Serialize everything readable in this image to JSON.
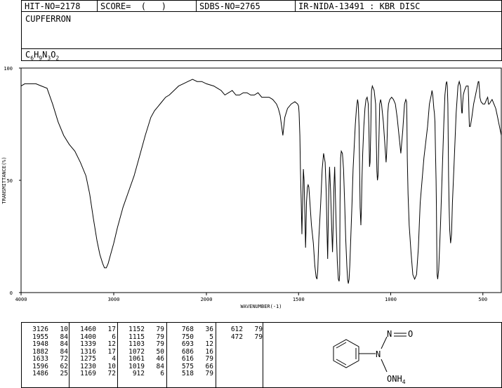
{
  "header": {
    "hit_no": "HIT-NO=2178",
    "score": "SCORE=  (   )",
    "sdbs_no": "SDBS-NO=2765",
    "ir_nida": "IR-NIDA-13491 : KBR DISC"
  },
  "compound": {
    "name": "CUPFERRON",
    "formula_parts": [
      "C",
      "6",
      "H",
      "9",
      "N",
      "3",
      "O",
      "2"
    ]
  },
  "chart_data": {
    "type": "line",
    "xlabel": "WAVENUMBER(-1)",
    "ylabel": "TRANSMITTANCE(%)",
    "xlim": [
      4000,
      400
    ],
    "ylim": [
      0,
      100
    ],
    "x_ticks": [
      "4000",
      "3000",
      "2000",
      "1500",
      "1000",
      "500"
    ],
    "y_ticks": [
      "100",
      "50",
      "0"
    ],
    "x": [
      4000,
      3960,
      3900,
      3840,
      3780,
      3720,
      3660,
      3600,
      3540,
      3480,
      3420,
      3360,
      3300,
      3260,
      3220,
      3180,
      3150,
      3120,
      3100,
      3080,
      3060,
      3040,
      3000,
      2960,
      2900,
      2840,
      2780,
      2720,
      2660,
      2600,
      2560,
      2520,
      2480,
      2440,
      2400,
      2350,
      2300,
      2250,
      2200,
      2150,
      2100,
      2050,
      2000,
      1960,
      1940,
      1920,
      1900,
      1880,
      1860,
      1840,
      1820,
      1800,
      1780,
      1760,
      1740,
      1720,
      1700,
      1680,
      1660,
      1640,
      1620,
      1610,
      1600,
      1595,
      1590,
      1585,
      1575,
      1560,
      1540,
      1520,
      1505,
      1500,
      1497,
      1493,
      1490,
      1486,
      1482,
      1478,
      1474,
      1470,
      1466,
      1462,
      1460,
      1457,
      1452,
      1448,
      1444,
      1440,
      1430,
      1420,
      1412,
      1405,
      1400,
      1396,
      1390,
      1380,
      1372,
      1364,
      1356,
      1350,
      1346,
      1342,
      1339,
      1336,
      1332,
      1326,
      1320,
      1316,
      1312,
      1308,
      1304,
      1300,
      1296,
      1290,
      1284,
      1280,
      1277,
      1275,
      1272,
      1268,
      1262,
      1256,
      1250,
      1244,
      1238,
      1234,
      1230,
      1226,
      1222,
      1216,
      1210,
      1204,
      1198,
      1192,
      1186,
      1180,
      1176,
      1172,
      1169,
      1166,
      1162,
      1159,
      1156,
      1152,
      1146,
      1140,
      1134,
      1128,
      1122,
      1118,
      1115,
      1112,
      1108,
      1106,
      1104,
      1100,
      1090,
      1082,
      1078,
      1075,
      1072,
      1069,
      1066,
      1062,
      1060,
      1055,
      1050,
      1040,
      1030,
      1025,
      1022,
      1019,
      1016,
      1012,
      1005,
      995,
      985,
      975,
      965,
      955,
      945,
      935,
      925,
      918,
      914,
      912,
      910,
      906,
      900,
      890,
      880,
      870,
      860,
      850,
      840,
      820,
      800,
      790,
      780,
      776,
      772,
      770,
      768,
      766,
      763,
      760,
      757,
      754,
      752,
      750,
      748,
      745,
      740,
      730,
      720,
      712,
      706,
      700,
      696,
      693,
      690,
      688,
      686,
      683,
      680,
      675,
      670,
      665,
      655,
      645,
      635,
      628,
      622,
      618,
      616,
      614,
      612,
      610,
      606,
      600,
      590,
      580,
      577,
      575,
      573,
      568,
      560,
      550,
      540,
      530,
      525,
      522,
      520,
      518,
      516,
      510,
      500,
      490,
      480,
      474,
      472,
      470,
      465,
      458,
      450,
      440,
      430,
      420,
      410,
      400
    ],
    "y": [
      92,
      93,
      93,
      93,
      92,
      91,
      84,
      76,
      70,
      66,
      63,
      58,
      52,
      44,
      33,
      23,
      17,
      13,
      11,
      11,
      13,
      16,
      22,
      29,
      38,
      45,
      52,
      61,
      70,
      78,
      81,
      83,
      85,
      87,
      88,
      90,
      92,
      93,
      94,
      95,
      94,
      94,
      93,
      92,
      91,
      90,
      88,
      89,
      90,
      88,
      88,
      89,
      89,
      88,
      88,
      89,
      87,
      87,
      87,
      86,
      84,
      82,
      79,
      76,
      73,
      70,
      78,
      82,
      84,
      85,
      84,
      83,
      80,
      70,
      55,
      42,
      26,
      40,
      55,
      50,
      35,
      20,
      27,
      40,
      47,
      48,
      47,
      42,
      30,
      22,
      12,
      7,
      6,
      10,
      24,
      40,
      55,
      62,
      58,
      45,
      28,
      15,
      30,
      46,
      56,
      45,
      28,
      18,
      30,
      47,
      56,
      42,
      30,
      14,
      6,
      5,
      8,
      40,
      60,
      63,
      62,
      55,
      40,
      24,
      12,
      6,
      4,
      6,
      12,
      26,
      40,
      55,
      65,
      75,
      82,
      86,
      84,
      74,
      58,
      38,
      30,
      38,
      50,
      62,
      74,
      82,
      86,
      87,
      84,
      72,
      56,
      58,
      72,
      85,
      90,
      92,
      90,
      84,
      68,
      54,
      50,
      52,
      62,
      75,
      84,
      86,
      84,
      76,
      64,
      58,
      62,
      70,
      80,
      84,
      86,
      87,
      86,
      84,
      78,
      70,
      62,
      72,
      84,
      86,
      85,
      76,
      60,
      44,
      30,
      18,
      8,
      6,
      8,
      20,
      40,
      60,
      74,
      84,
      88,
      90,
      88,
      86,
      84,
      82,
      80,
      76,
      62,
      50,
      38,
      20,
      8,
      6,
      10,
      30,
      55,
      75,
      88,
      93,
      94,
      92,
      84,
      68,
      52,
      38,
      28,
      22,
      26,
      40,
      60,
      80,
      92,
      94,
      92,
      86,
      82,
      80,
      80,
      84,
      88,
      90,
      92,
      92,
      86,
      78,
      74,
      74,
      78,
      84,
      88,
      92,
      94,
      94,
      92,
      90,
      87,
      85,
      84,
      84,
      86,
      87,
      86,
      84,
      84,
      85,
      86,
      84,
      82,
      78,
      74,
      70,
      68
    ]
  },
  "peaks": [
    [
      [
        "3126",
        "10"
      ],
      [
        "1955",
        "84"
      ],
      [
        "1948",
        "84"
      ],
      [
        "1882",
        "84"
      ],
      [
        "1633",
        "72"
      ],
      [
        "1596",
        "62"
      ],
      [
        "1486",
        "25"
      ]
    ],
    [
      [
        "1460",
        "17"
      ],
      [
        "1400",
        "6"
      ],
      [
        "1339",
        "12"
      ],
      [
        "1316",
        "17"
      ],
      [
        "1275",
        "4"
      ],
      [
        "1230",
        "10"
      ],
      [
        "1169",
        "72"
      ]
    ],
    [
      [
        "1152",
        "79"
      ],
      [
        "1115",
        "79"
      ],
      [
        "1103",
        "79"
      ],
      [
        "1072",
        "50"
      ],
      [
        "1061",
        "46"
      ],
      [
        "1019",
        "84"
      ],
      [
        "912",
        "6"
      ]
    ],
    [
      [
        "768",
        "36"
      ],
      [
        "750",
        "5"
      ],
      [
        "693",
        "12"
      ],
      [
        "686",
        "16"
      ],
      [
        "616",
        "79"
      ],
      [
        "575",
        "66"
      ],
      [
        "518",
        "79"
      ]
    ],
    [
      [
        "612",
        "79"
      ],
      [
        "472",
        "79"
      ]
    ]
  ],
  "structure": {
    "nitroso_n": "N",
    "nitroso_o": "O",
    "amine_n": "N",
    "onh4": "ONH",
    "onh4_sub": "4"
  }
}
